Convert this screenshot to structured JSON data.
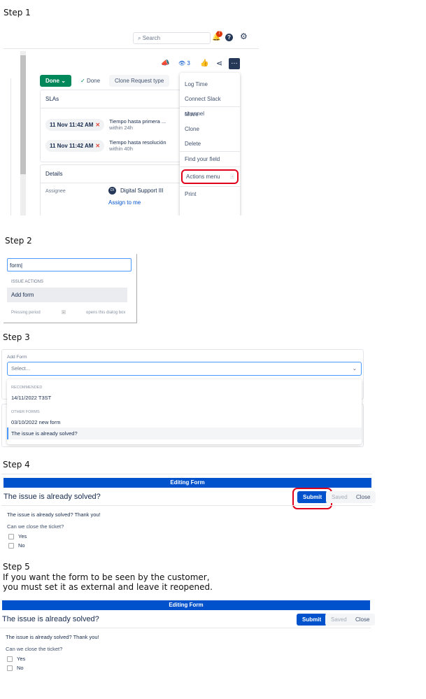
{
  "steps": [
    "Step 1",
    "Step 2",
    "Step 3",
    "Step 4",
    "Step 5"
  ],
  "step1": {
    "search_placeholder": "Search",
    "notif_count": "7",
    "watch_count": "3",
    "status_button": "Done",
    "resolution": "Done",
    "clone_button": "Clone Request type",
    "slas_title": "SLAs",
    "slas": [
      {
        "time": "11 Nov 11:42 AM",
        "name": "Tiempo hasta primera ...",
        "within": "within 24h"
      },
      {
        "time": "11 Nov 11:42 AM",
        "name": "Tiempo hasta resolución",
        "within": "within 40h"
      }
    ],
    "details_title": "Details",
    "assignee_label": "Assignee",
    "assignee_initials": "DI",
    "assignee": "Digital Support III",
    "assign_to_me": "Assign to me",
    "menu": [
      "Log Time",
      "Connect Slack channel",
      "Move",
      "Clone",
      "Delete",
      "Find your field",
      "Actions menu",
      "Print"
    ],
    "menu_shortcut": "."
  },
  "step2": {
    "query": "form",
    "section": "ISSUE ACTIONS",
    "result": "Add form",
    "hint_left": "Pressing period",
    "hint_key": ".",
    "hint_right": "opens this dialog box"
  },
  "step3": {
    "label": "Add Form",
    "placeholder": "Select...",
    "recommended": "RECOMMENDED",
    "rec_items": [
      "14/11/2022 T3ST"
    ],
    "other": "OTHER FORMS",
    "other_items": [
      "03/10/2022 new form",
      "The issue is already solved?"
    ]
  },
  "step5_note": [
    "If you want the form to be seen by the customer,",
    "you must set it as external and leave it reopened."
  ],
  "form": {
    "bar": "Editing Form",
    "title": "The issue is already solved?",
    "submit": "Submit",
    "saved": "Saved",
    "close": "Close",
    "intro": "The issue is already solved? Thank you!",
    "question": "Can we close the ticket?",
    "options": [
      "Yes",
      "No"
    ]
  }
}
